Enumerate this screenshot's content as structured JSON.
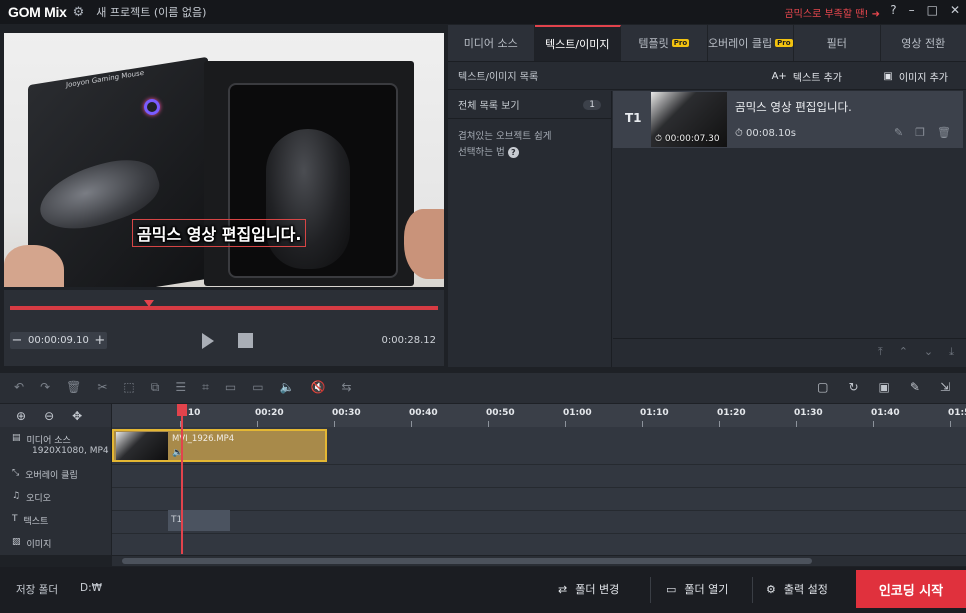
{
  "app": {
    "logo": "GOM Mix",
    "project_title": "새 프로젝트 (이름 없음)",
    "promo": "곰믹스로 부족할 땐! ➜",
    "help": "?"
  },
  "preview": {
    "subtitle": "곰믹스 영상 편집입니다.",
    "package_text": "Jooyon Gaming Mouse"
  },
  "player": {
    "current_time": "00:00:09.10",
    "duration": "0:00:28.12",
    "progress_fraction": 0.325
  },
  "tabs": [
    {
      "label": "미디어 소스",
      "pro": false
    },
    {
      "label": "텍스트/이미지",
      "pro": false,
      "active": true
    },
    {
      "label": "템플릿",
      "pro": true
    },
    {
      "label": "오버레이 클립",
      "pro": true
    },
    {
      "label": "필터",
      "pro": false
    },
    {
      "label": "영상 전환",
      "pro": false
    }
  ],
  "pro_badge": "Pro",
  "text_panel": {
    "header": "텍스트/이미지 목록",
    "add_text": "텍스트 추가",
    "add_image": "이미지 추가",
    "view_all": "전체 목록 보기",
    "count": "1",
    "hint_line1": "겹쳐있는 오브젝트 쉽게",
    "hint_line2": "선택하는 법",
    "item": {
      "tag": "T1",
      "title": "곰믹스 영상 편집입니다.",
      "start": "00:00:07.30",
      "duration": "00:08.10s"
    }
  },
  "ruler": [
    "0:10",
    "00:20",
    "00:30",
    "00:40",
    "00:50",
    "01:00",
    "01:10",
    "01:20",
    "01:30",
    "01:40",
    "01:50"
  ],
  "tracks": {
    "media_source": "미디어 소스",
    "media_res": "1920X1080, MP4",
    "overlay": "오버레이 클립",
    "audio": "오디오",
    "text": "텍스트",
    "image": "이미지"
  },
  "clip": {
    "name": "MVI_1926.MP4",
    "text_clip": "T1"
  },
  "bottom": {
    "save_folder_label": "저장 폴더",
    "save_path": "D:₩",
    "change_folder": "폴더 변경",
    "open_folder": "폴더 열기",
    "output_settings": "출력 설정",
    "encode_start": "인코딩 시작"
  },
  "colors": {
    "accent": "#e2434c",
    "pro_badge": "#f2c210",
    "clip_border": "#e4b733"
  }
}
